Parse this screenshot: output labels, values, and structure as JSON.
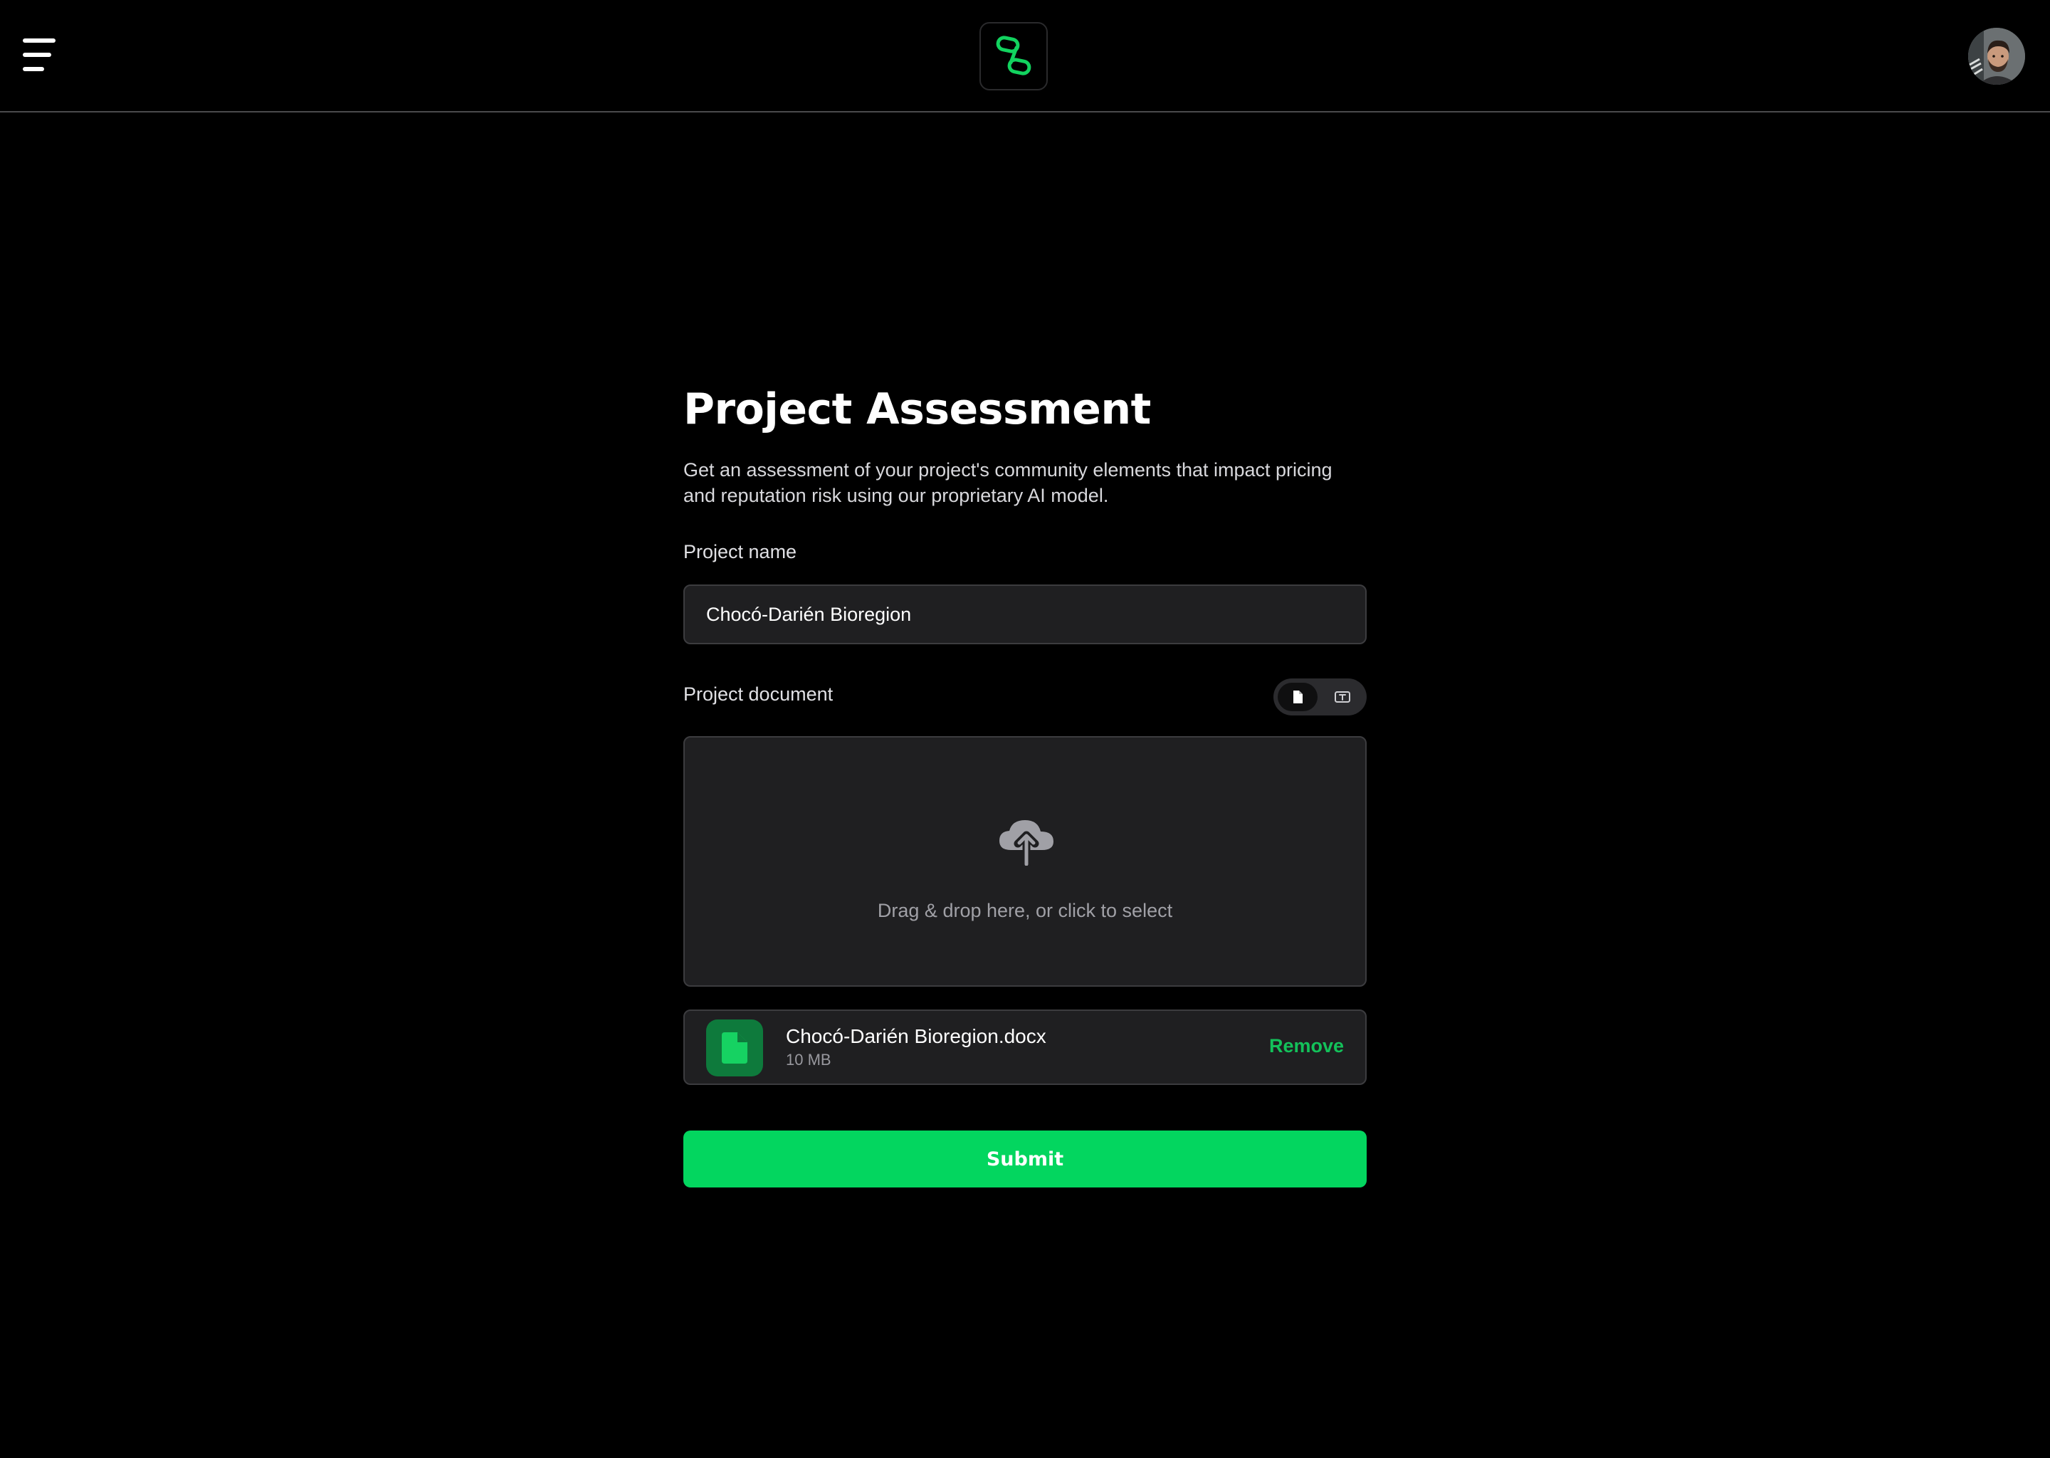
{
  "header": {
    "menu_icon": "hamburger-menu-icon",
    "logo_icon": "chain-link-logo-icon",
    "avatar_icon": "user-avatar",
    "accent_color": "#03d65f"
  },
  "assessment": {
    "title": "Project Assessment",
    "description": "Get an assessment of your project's community elements that impact pricing and reputation risk using our proprietary AI model.",
    "project_name_label": "Project name",
    "project_name_value": "Chocó-Darién Bioregion",
    "project_document_label": "Project document",
    "toggle": {
      "options": [
        "file-icon",
        "text-box-icon"
      ],
      "selected": "file-icon"
    },
    "dropzone": {
      "icon": "cloud-upload-icon",
      "hint": "Drag & drop here, or click to select"
    },
    "file": {
      "icon": "document-icon",
      "name": "Chocó-Darién Bioregion.docx",
      "size": "10 MB",
      "remove_label": "Remove"
    },
    "submit_label": "Submit"
  }
}
